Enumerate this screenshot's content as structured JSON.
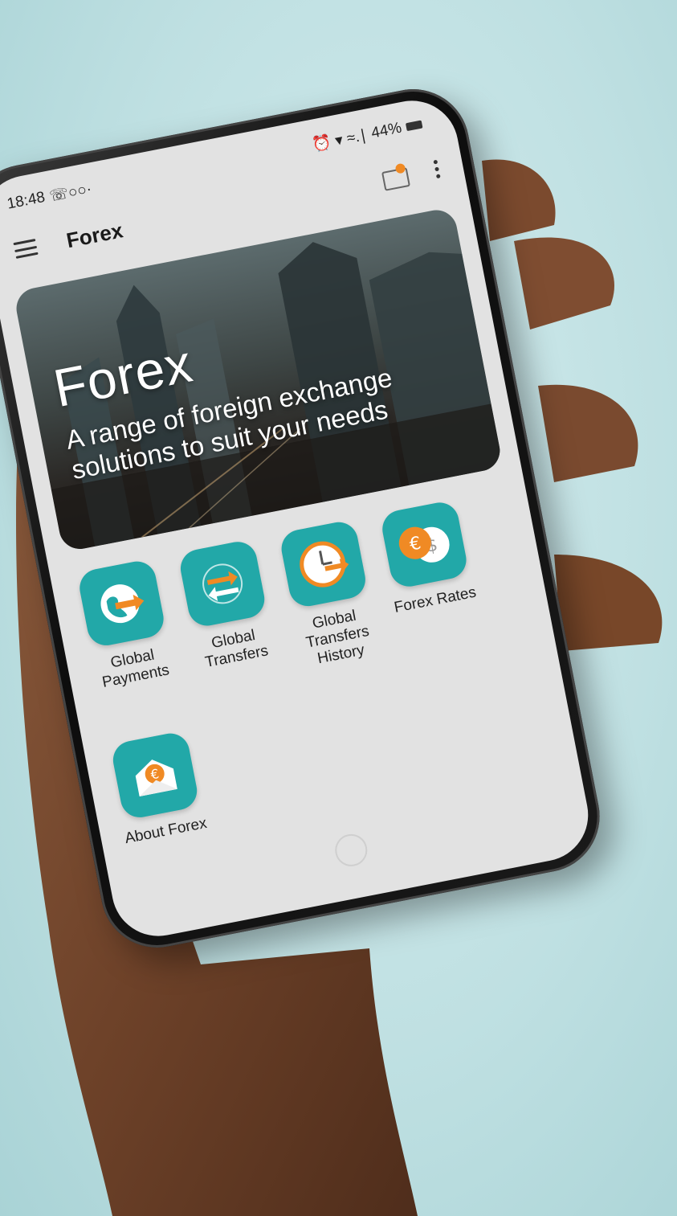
{
  "status_bar": {
    "time": "18:48",
    "left_icons": "☏○○·",
    "right_icons": "⏰ ▾ ≈.∣",
    "battery": "44%"
  },
  "app_bar": {
    "title": "Forex",
    "menu_icon": "hamburger-icon",
    "notification_icon": "chat-notification-icon",
    "more_icon": "more-vertical-icon"
  },
  "hero": {
    "title": "Forex",
    "subtitle": "A range of foreign exchange solutions to suit your needs"
  },
  "tiles": [
    {
      "label": "Global Payments",
      "icon": "globe-arrow-icon"
    },
    {
      "label": "Global Transfers",
      "icon": "transfer-arrows-icon"
    },
    {
      "label": "Global Transfers History",
      "icon": "clock-arrow-icon"
    },
    {
      "label": "Forex Rates",
      "icon": "currency-coins-icon"
    },
    {
      "label": "About Forex",
      "icon": "envelope-euro-icon"
    }
  ],
  "colors": {
    "tile_background": "#22a8a8",
    "accent_orange": "#f08a24",
    "screen_background": "#e2e2e2",
    "backdrop": "#bfe0e2"
  }
}
